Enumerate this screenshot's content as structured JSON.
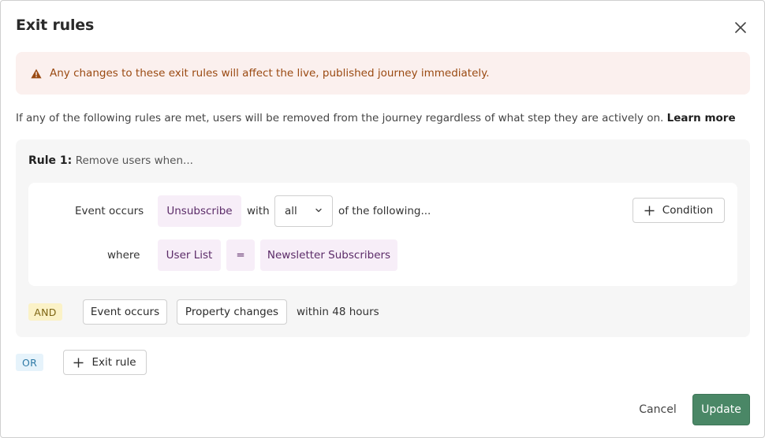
{
  "dialog": {
    "title": "Exit rules",
    "close_icon": "close-icon"
  },
  "warning": {
    "icon": "warning-triangle-icon",
    "text": "Any changes to these exit rules will affect the live, published journey immediately.",
    "colors": {
      "background": "#fbf0ee",
      "text": "#9a4a12"
    }
  },
  "info": {
    "text": "If any of the following rules are met, users will be removed from the journey regardless of what step they are actively on.",
    "learn_more": "Learn more"
  },
  "rule": {
    "number_label": "Rule 1:",
    "subtitle": "Remove users when...",
    "condition": {
      "label": "Event occurs",
      "event": "Unsubscribe",
      "with_text": "with",
      "match_select": "all",
      "following_text": "of the following...",
      "add_condition_label": "Condition",
      "where_label": "where",
      "property": "User List",
      "operator": "=",
      "value": "Newsletter Subscribers"
    },
    "and_badge": "AND",
    "and_event_button": "Event occurs",
    "and_property_button": "Property changes",
    "within_text": "within 48 hours"
  },
  "or_badge": "OR",
  "add_exit_rule_label": "Exit rule",
  "footer": {
    "cancel_label": "Cancel",
    "update_label": "Update",
    "colors": {
      "update_background": "#4a8766"
    }
  }
}
